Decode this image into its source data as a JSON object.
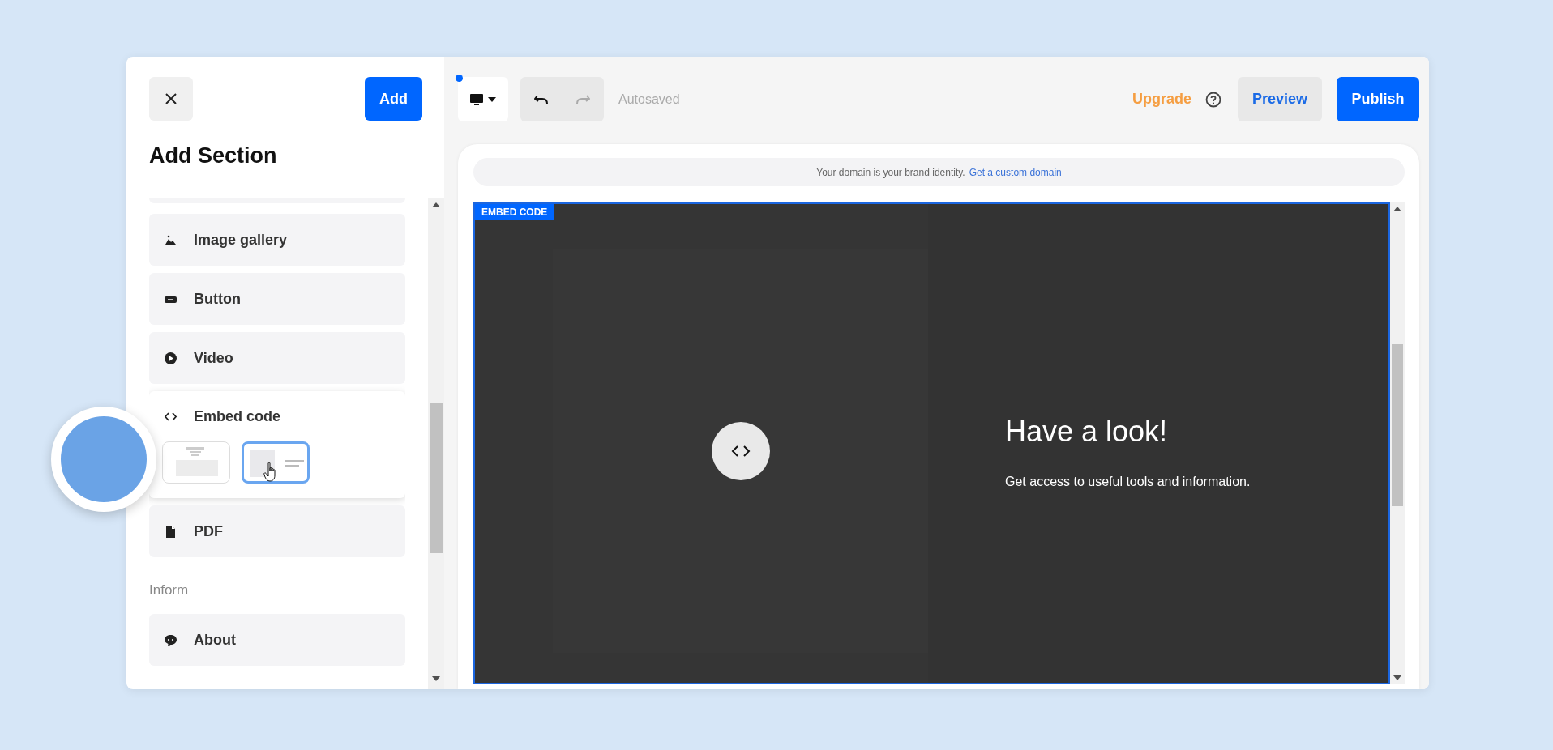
{
  "sidebar": {
    "add_button": "Add",
    "title": "Add Section",
    "items": [
      {
        "kind": "item",
        "label": "Image gallery",
        "expanded": false
      },
      {
        "kind": "item",
        "label": "Button",
        "expanded": false
      },
      {
        "kind": "item",
        "label": "Video",
        "expanded": false
      },
      {
        "kind": "item",
        "label": "Embed code",
        "expanded": true,
        "layouts": [
          {
            "selected": false
          },
          {
            "selected": true
          }
        ]
      },
      {
        "kind": "item",
        "label": "PDF",
        "expanded": false
      },
      {
        "kind": "header",
        "label": "Inform"
      },
      {
        "kind": "item",
        "label": "About",
        "expanded": false
      }
    ]
  },
  "toolbar": {
    "undo": {
      "disabled": false
    },
    "redo": {
      "disabled": true
    },
    "status": "Autosaved",
    "upgrade": "Upgrade",
    "preview": "Preview",
    "publish": "Publish"
  },
  "canvas": {
    "domain_bar": {
      "text": "Your domain is your brand identity.",
      "link": "Get a custom domain"
    },
    "embed_block": {
      "label": "EMBED CODE",
      "heading": "Have a look!",
      "text": "Get access to useful tools and information."
    }
  }
}
